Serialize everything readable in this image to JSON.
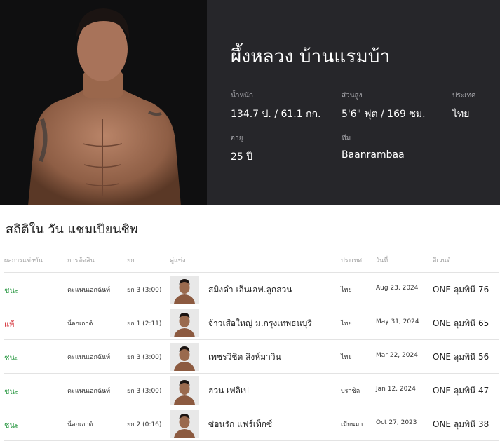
{
  "fighter": {
    "name": "ผึ้งหลวง บ้านแรมบ้า",
    "stats": [
      {
        "label": "น้ำหนัก",
        "value": "134.7 ป. / 61.1 กก."
      },
      {
        "label": "ส่วนสูง",
        "value": "5'6\" ฟุต / 169 ซม."
      },
      {
        "label": "ประเทศ",
        "value": "ไทย"
      },
      {
        "label": "อายุ",
        "value": "25 ปี"
      },
      {
        "label": "ทีม",
        "value": "Baanrambaa"
      }
    ]
  },
  "section": {
    "title": "สถิติใน วัน แชมเปียนชิพ"
  },
  "table": {
    "headers": [
      "ผลการแข่งขัน",
      "การตัดสิน",
      "ยก",
      "คู่แข่ง",
      "ประเทศ",
      "วันที่",
      "อีเวนต์"
    ],
    "rows": [
      {
        "result": "ชนะ",
        "outcome": "win",
        "method": "คะแนนเอกฉันท์",
        "round": "ยก 3 (3:00)",
        "opponent": "สมิงดำ เอ็นเอฟ.ลูกสวน",
        "country": "ไทย",
        "date": "Aug 23, 2024",
        "event": "ONE ลุมพินี 76"
      },
      {
        "result": "แพ้",
        "outcome": "loss",
        "method": "น็อกเอาต์",
        "round": "ยก 1 (2:11)",
        "opponent": "จ้าวเสือใหญ่ ม.กรุงเทพธนบุรี",
        "country": "ไทย",
        "date": "May 31, 2024",
        "event": "ONE ลุมพินี 65"
      },
      {
        "result": "ชนะ",
        "outcome": "win",
        "method": "คะแนนเอกฉันท์",
        "round": "ยก 3 (3:00)",
        "opponent": "เพชรวิชิต สิงห์มาวิน",
        "country": "ไทย",
        "date": "Mar 22, 2024",
        "event": "ONE ลุมพินี 56"
      },
      {
        "result": "ชนะ",
        "outcome": "win",
        "method": "คะแนนเอกฉันท์",
        "round": "ยก 3 (3:00)",
        "opponent": "ฮวน เฟลิเป",
        "country": "บราซิล",
        "date": "Jan 12, 2024",
        "event": "ONE ลุมพินี 47"
      },
      {
        "result": "ชนะ",
        "outcome": "win",
        "method": "น็อกเอาต์",
        "round": "ยก 2 (0:16)",
        "opponent": "ซ่อนรัก แฟร์เท็กซ์",
        "country": "เมียนมา",
        "date": "Oct 27, 2023",
        "event": "ONE ลุมพินี 38"
      }
    ]
  },
  "colors": {
    "hero_bg": "#26262a",
    "photo_bg": "#0f0f10",
    "win": "#2e9a46",
    "loss": "#d2262e"
  }
}
